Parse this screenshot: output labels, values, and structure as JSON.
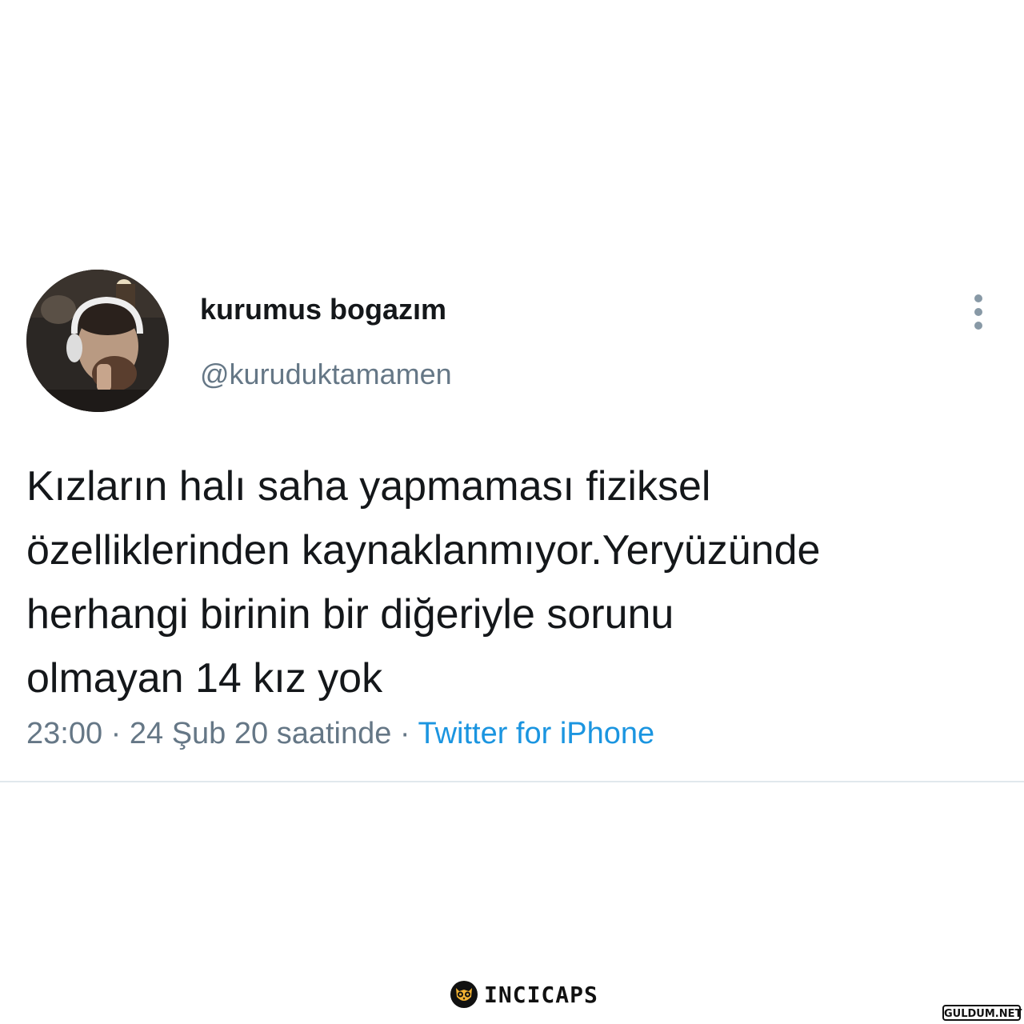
{
  "tweet": {
    "display_name": "kurumus bogazım",
    "handle": "@kuruduktamamen",
    "avatar_icon": "user-avatar-photo",
    "menu_icon": "more-vertical-icon",
    "text_lines": [
      "Kızların halı saha yapmaması fiziksel",
      "özelliklerinden kaynaklanmıyor.Yeryüzünde",
      "herhangi birinin bir diğeriyle sorunu",
      "olmayan 14 kız yok"
    ],
    "time": "23:00",
    "separator": " · ",
    "date": "24 Şub 20 saatinde",
    "source": "Twitter for iPhone"
  },
  "footer": {
    "brand_logo_icon": "owl-icon",
    "brand_name": "INCICAPS",
    "watermark": "GULDUM.NET"
  },
  "colors": {
    "text": "#14171a",
    "secondary": "#657786",
    "link": "#1b95e0",
    "divider": "#e1e8ed",
    "menu_dots": "#8899a6"
  }
}
